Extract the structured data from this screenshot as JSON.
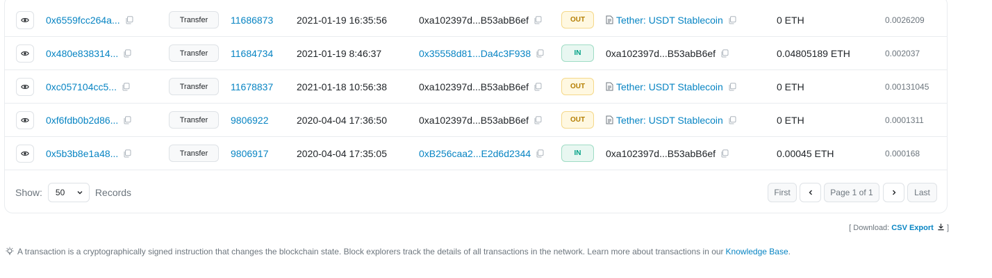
{
  "rows": [
    {
      "hash": "0x6559fcc264a...",
      "method": "Transfer",
      "block": "11686873",
      "age": "2021-01-19 16:35:56",
      "from": "0xa102397d...B53abB6ef",
      "from_link": false,
      "direction": "OUT",
      "to": "Tether: USDT Stablecoin",
      "to_link": true,
      "value": "0 ETH",
      "fee": "0.0026209"
    },
    {
      "hash": "0x480e838314...",
      "method": "Transfer",
      "block": "11684734",
      "age": "2021-01-19 8:46:37",
      "from": "0x35558d81...Da4c3F938",
      "from_link": true,
      "direction": "IN",
      "to": "0xa102397d...B53abB6ef",
      "to_link": false,
      "value": "0.04805189 ETH",
      "fee": "0.002037"
    },
    {
      "hash": "0xc057104cc5...",
      "method": "Transfer",
      "block": "11678837",
      "age": "2021-01-18 10:56:38",
      "from": "0xa102397d...B53abB6ef",
      "from_link": false,
      "direction": "OUT",
      "to": "Tether: USDT Stablecoin",
      "to_link": true,
      "value": "0 ETH",
      "fee": "0.00131045"
    },
    {
      "hash": "0xf6fdb0b2d86...",
      "method": "Transfer",
      "block": "9806922",
      "age": "2020-04-04 17:36:50",
      "from": "0xa102397d...B53abB6ef",
      "from_link": false,
      "direction": "OUT",
      "to": "Tether: USDT Stablecoin",
      "to_link": true,
      "value": "0 ETH",
      "fee": "0.0001311"
    },
    {
      "hash": "0x5b3b8e1a48...",
      "method": "Transfer",
      "block": "9806917",
      "age": "2020-04-04 17:35:05",
      "from": "0xB256caa2...E2d6d2344",
      "from_link": true,
      "direction": "IN",
      "to": "0xa102397d...B53abB6ef",
      "to_link": false,
      "value": "0.00045 ETH",
      "fee": "0.000168"
    }
  ],
  "footer": {
    "show_label": "Show:",
    "page_size": "50",
    "records_label": "Records",
    "first": "First",
    "prev": "<",
    "page_info": "Page 1 of 1",
    "next": ">",
    "last": "Last"
  },
  "download": {
    "prefix": "[ Download:",
    "csv": "CSV Export",
    "suffix": "]"
  },
  "info": {
    "text": "A transaction is a cryptographically signed instruction that changes the blockchain state. Block explorers track the details of all transactions in the network. Learn more about transactions in our",
    "link": "Knowledge Base",
    "end": "."
  },
  "colors": {
    "link": "#0784c3",
    "out": "#b47d00",
    "in": "#00a186"
  },
  "icons": {
    "preview": "eye-icon",
    "copy": "copy-icon",
    "contract": "document-icon",
    "dropdown": "chevron-down-icon",
    "download": "download-icon",
    "tip": "lightbulb-icon"
  }
}
